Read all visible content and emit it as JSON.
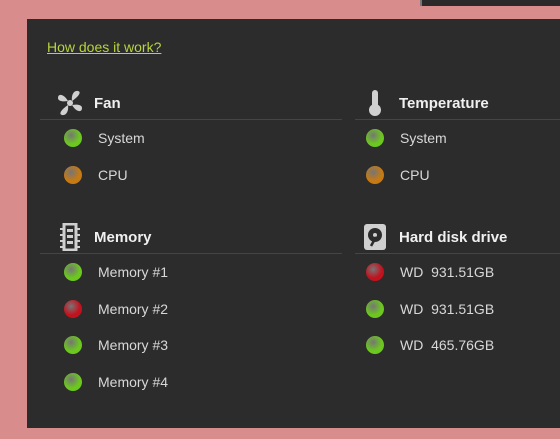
{
  "help_link": "How does it work?",
  "status_colors": {
    "ok": "#6cc81e",
    "warn": "#c77a12",
    "error": "#c2121e"
  },
  "sections": {
    "fan": {
      "title": "Fan",
      "icon": "fan-icon",
      "items": [
        {
          "label": "System",
          "status": "ok"
        },
        {
          "label": "CPU",
          "status": "warn"
        }
      ]
    },
    "temperature": {
      "title": "Temperature",
      "icon": "thermometer-icon",
      "items": [
        {
          "label": "System",
          "status": "ok"
        },
        {
          "label": "CPU",
          "status": "warn"
        }
      ]
    },
    "memory": {
      "title": "Memory",
      "icon": "memory-icon",
      "items": [
        {
          "label": "Memory #1",
          "status": "ok"
        },
        {
          "label": "Memory #2",
          "status": "error"
        },
        {
          "label": "Memory #3",
          "status": "ok"
        },
        {
          "label": "Memory #4",
          "status": "ok"
        }
      ]
    },
    "hdd": {
      "title": "Hard disk drive",
      "icon": "hard-disk-icon",
      "items": [
        {
          "label": "WD  931.51GB",
          "status": "error"
        },
        {
          "label": "WD  931.51GB",
          "status": "ok"
        },
        {
          "label": "WD  465.76GB",
          "status": "ok"
        }
      ]
    }
  }
}
